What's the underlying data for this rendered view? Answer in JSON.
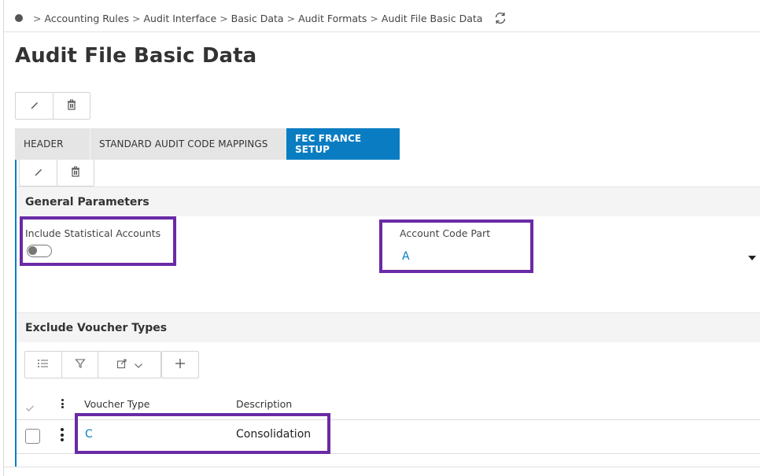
{
  "breadcrumb": {
    "items": [
      "Accounting Rules",
      "Audit Interface",
      "Basic Data",
      "Audit Formats",
      "Audit File Basic Data"
    ],
    "separator": ">"
  },
  "page": {
    "title": "Audit File Basic Data"
  },
  "tabs": [
    {
      "label": "HEADER",
      "active": false
    },
    {
      "label": "STANDARD AUDIT CODE MAPPINGS",
      "active": false
    },
    {
      "label": "FEC FRANCE SETUP",
      "active": true
    }
  ],
  "general_parameters": {
    "title": "General Parameters",
    "include_statistical_accounts": {
      "label": "Include Statistical Accounts",
      "value": false
    },
    "account_code_part": {
      "label": "Account Code Part",
      "value": "A"
    }
  },
  "exclude_voucher_types": {
    "title": "Exclude Voucher Types",
    "columns": [
      "Voucher Type",
      "Description"
    ],
    "rows": [
      {
        "voucher_type": "C",
        "description": "Consolidation"
      }
    ]
  },
  "colors": {
    "accent": "#0a7dc2",
    "highlight": "#6a2aa6"
  },
  "icons": [
    "refresh-icon",
    "edit-icon",
    "delete-icon",
    "list-settings-icon",
    "filter-icon",
    "export-icon",
    "chevron-down-icon",
    "add-icon",
    "kebab-icon",
    "checkmark-icon"
  ]
}
